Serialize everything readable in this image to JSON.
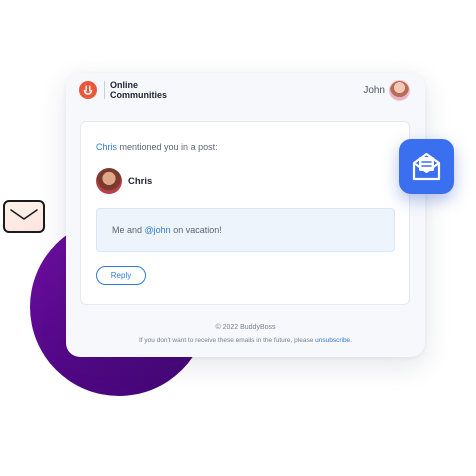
{
  "brand": {
    "name_line1": "Online",
    "name_line2": "Communities"
  },
  "header": {
    "user_name": "John"
  },
  "notification": {
    "actor": "Chris",
    "message_suffix": " mentioned you in a post:",
    "author_name": "Chris",
    "post_prefix": "Me and ",
    "post_mention": "@john",
    "post_suffix": " on vacation!",
    "reply_label": "Reply"
  },
  "footer": {
    "copyright": "© 2022 BuddyBoss",
    "unsubscribe_prefix": "If you don't want to receive these emails in the future, please ",
    "unsubscribe_link": "unsubscribe",
    "unsubscribe_suffix": "."
  },
  "icons": {
    "logo": "buddyboss-logo-icon",
    "floating_envelope": "envelope-icon",
    "mail_badge": "open-mail-icon"
  },
  "colors": {
    "accent": "#2f7bd9",
    "logo": "#e8583a",
    "badge": "#3a6ff0",
    "circle": "#5f0a94"
  }
}
